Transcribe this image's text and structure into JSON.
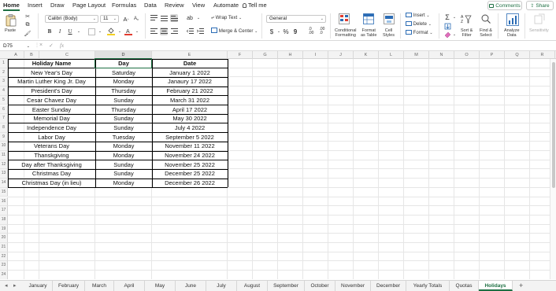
{
  "menu": {
    "items": [
      "Home",
      "Insert",
      "Draw",
      "Page Layout",
      "Formulas",
      "Data",
      "Review",
      "View",
      "Automate"
    ],
    "tell_me": "Tell me",
    "comments": "Comments",
    "share": "Share"
  },
  "ribbon": {
    "paste": "Paste",
    "font_name": "Calibri (Body)",
    "font_size": "11",
    "wrap_text": "Wrap Text",
    "merge_center": "Merge & Center",
    "number_format": "General",
    "currency": "$",
    "percent": "%",
    "comma": "9",
    "conditional_formatting": [
      "Conditional",
      "Formatting"
    ],
    "format_as_table": [
      "Format",
      "as Table"
    ],
    "cell_styles": [
      "Cell",
      "Styles"
    ],
    "insert": "Insert",
    "delete": "Delete",
    "format": "Format",
    "sort_filter": [
      "Sort &",
      "Filter"
    ],
    "find_select": [
      "Find &",
      "Select"
    ],
    "analyze_data": [
      "Analyze",
      "Data"
    ],
    "sensitivity": "Sensitivity",
    "bold": "B",
    "italic": "I",
    "underline": "U",
    "font_grow": "A",
    "font_shrink": "A"
  },
  "formula_bar": {
    "name_box": "D75",
    "cancel": "×",
    "enter": "✓",
    "fx": "fx",
    "value": ""
  },
  "columns": [
    "A",
    "B",
    "C",
    "D",
    "E",
    "F",
    "G",
    "H",
    "I",
    "J",
    "K",
    "L",
    "M",
    "N",
    "O",
    "P",
    "Q",
    "R"
  ],
  "rows": [
    "1",
    "2",
    "3",
    "4",
    "5",
    "6",
    "7",
    "8",
    "9",
    "10",
    "11",
    "12",
    "13",
    "14",
    "15",
    "16",
    "17",
    "18",
    "19",
    "20",
    "21",
    "22",
    "23",
    "24"
  ],
  "table": {
    "headers": [
      "Holiday Name",
      "Day",
      "Date"
    ],
    "rows": [
      [
        "New Year's Day",
        "Saturday",
        "January 1 2022"
      ],
      [
        "Martin Luther King Jr. Day",
        "Monday",
        "Janaury 17 2022"
      ],
      [
        "President's Day",
        "Thursday",
        "February 21 2022"
      ],
      [
        "Cesar Chavez Day",
        "Sunday",
        "March 31 2022"
      ],
      [
        "Easter Sunday",
        "Thursday",
        "April 17 2022"
      ],
      [
        "Memorial Day",
        "Sunday",
        "May 30 2022"
      ],
      [
        "Independence Day",
        "Sunday",
        "July 4 2022"
      ],
      [
        "Labor Day",
        "Tuesday",
        "September 5 2022"
      ],
      [
        "Veterans Day",
        "Monday",
        "November 11 2022"
      ],
      [
        "Thanskgiving",
        "Monday",
        "November 24 2022"
      ],
      [
        "Day after Thanksgiving",
        "Sunday",
        "November 25 2022"
      ],
      [
        "Christmas Day",
        "Sunday",
        "December 25 2022"
      ],
      [
        "Christmas Day (in lieu)",
        "Monday",
        "December 26 2022"
      ]
    ]
  },
  "sheet_tabs": [
    "January",
    "February",
    "March",
    "April",
    "May",
    "June",
    "July",
    "August",
    "September",
    "October",
    "November",
    "December",
    "Yearly Totals",
    "Quotas",
    "Holidays"
  ],
  "active_sheet": "Holidays",
  "add_sheet": "+",
  "colors": {
    "accent": "#1d6f42"
  }
}
